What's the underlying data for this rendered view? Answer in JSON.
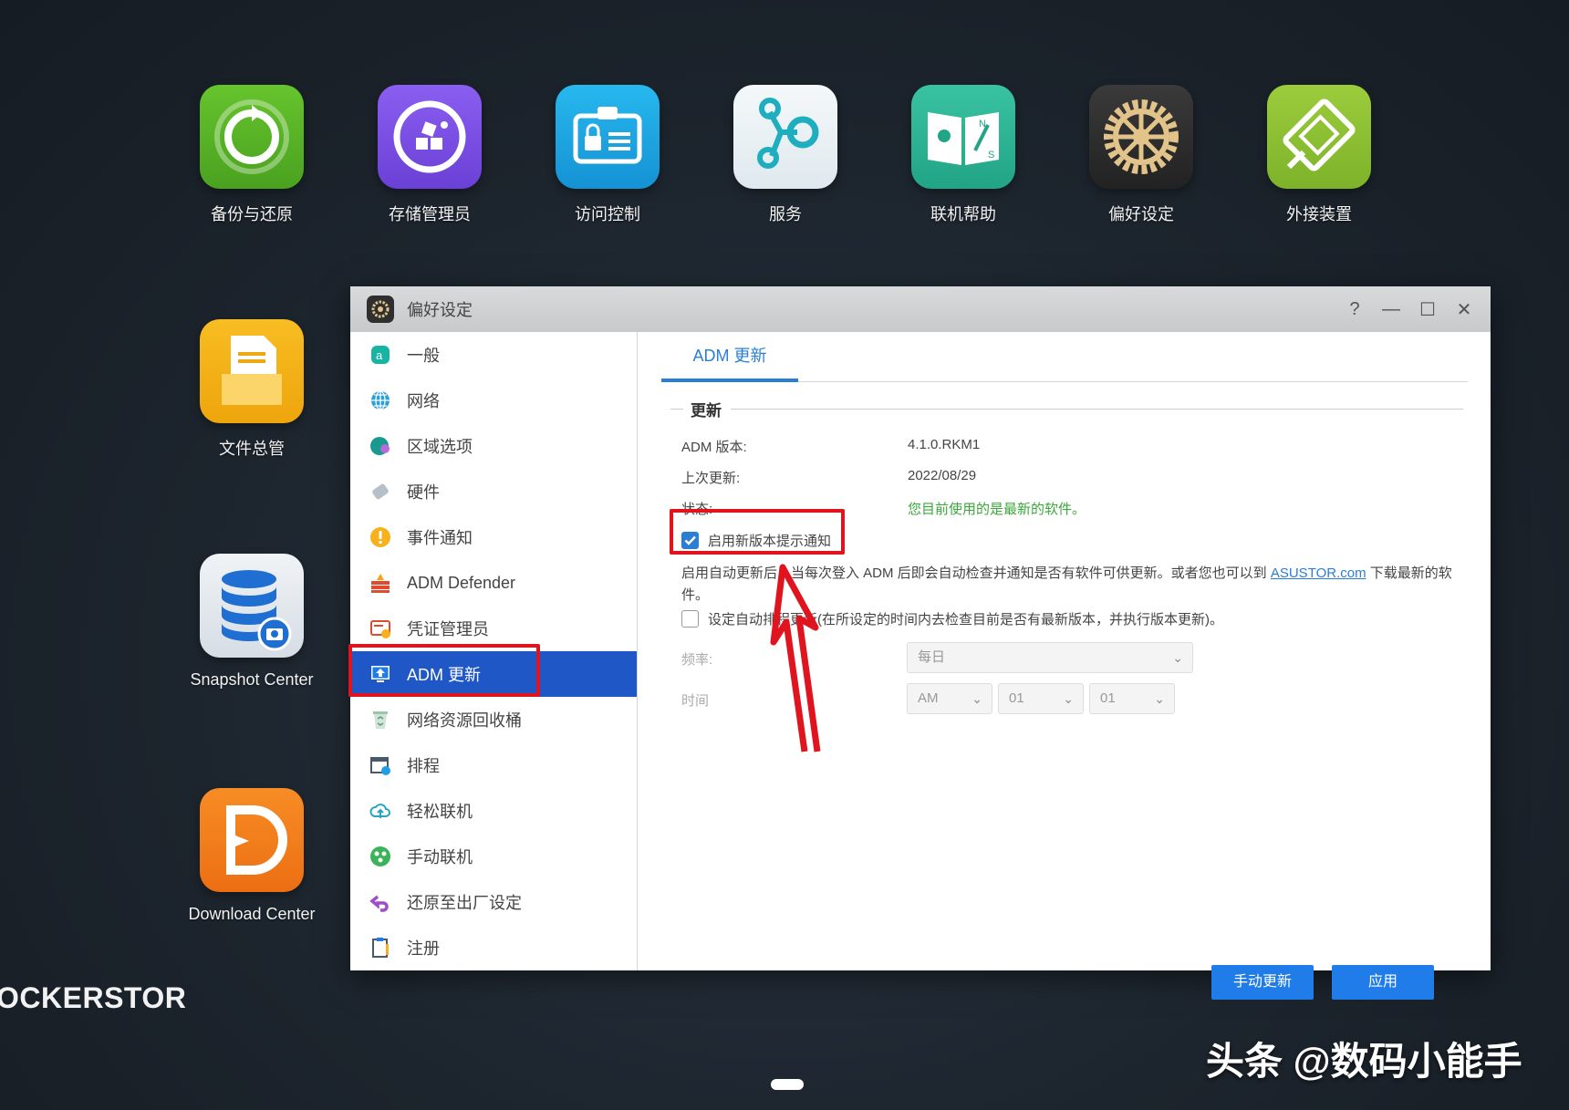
{
  "desktop": {
    "icons": [
      {
        "label": "备份与还原",
        "color": "#5cb82a"
      },
      {
        "label": "存储管理员",
        "color": "#7d52e0"
      },
      {
        "label": "访问控制",
        "color": "#1aa4e0"
      },
      {
        "label": "服务",
        "color": "#e8f2f5"
      },
      {
        "label": "联机帮助",
        "color": "#2eb396"
      },
      {
        "label": "偏好设定",
        "color": "#2c2c2c"
      },
      {
        "label": "外接装置",
        "color": "#8bc43a"
      },
      {
        "label": "文件总管",
        "color": "#f3b017"
      },
      {
        "label": "Snapshot Center",
        "color": "#e6eaee"
      },
      {
        "label": "Download Center",
        "color": "#f07d1c"
      }
    ],
    "brand_text": "OCKERSTOR",
    "watermark": "头条 @数码小能手"
  },
  "window": {
    "title": "偏好设定",
    "controls": {
      "help": "?",
      "minimize": "—",
      "maximize": "☐",
      "close": "✕"
    },
    "sidebar": {
      "items": [
        {
          "label": "一般",
          "icon": "general-icon"
        },
        {
          "label": "网络",
          "icon": "globe-icon"
        },
        {
          "label": "区域选项",
          "icon": "region-icon"
        },
        {
          "label": "硬件",
          "icon": "hardware-icon"
        },
        {
          "label": "事件通知",
          "icon": "alert-icon"
        },
        {
          "label": "ADM Defender",
          "icon": "firewall-icon"
        },
        {
          "label": "凭证管理员",
          "icon": "certificate-icon"
        },
        {
          "label": "ADM 更新",
          "icon": "update-icon"
        },
        {
          "label": "网络资源回收桶",
          "icon": "recycle-bin-icon"
        },
        {
          "label": "排程",
          "icon": "calendar-icon"
        },
        {
          "label": "轻松联机",
          "icon": "cloud-icon"
        },
        {
          "label": "手动联机",
          "icon": "network-icon"
        },
        {
          "label": "还原至出厂设定",
          "icon": "undo-icon"
        },
        {
          "label": "注册",
          "icon": "clipboard-icon"
        }
      ],
      "active_index": 7
    },
    "tab": "ADM 更新",
    "section": "更新",
    "fields": {
      "version_label": "ADM 版本:",
      "version_value": "4.1.0.RKM1",
      "last_update_label": "上次更新:",
      "last_update_value": "2022/08/29",
      "status_label": "状态:",
      "status_value": "您目前使用的是最新的软件。"
    },
    "notify_checkbox": {
      "label": "启用新版本提示通知",
      "checked": true
    },
    "description": {
      "before_link": "启用自动更新后，当每次登入 ADM 后即会自动检查并通知是否有软件可供更新。或者您也可以到 ",
      "link": "ASUSTOR.com",
      "after_link": " 下载最新的软件。"
    },
    "schedule_checkbox": {
      "label": "设定自动排程更新(在所设定的时间内去检查目前是否有最新版本，并执行版本更新)。",
      "checked": false
    },
    "frequency": {
      "label": "频率:",
      "value": "每日"
    },
    "time": {
      "label": "时间",
      "ampm": "AM",
      "hour": "01",
      "minute": "01"
    },
    "buttons": {
      "manual_update": "手动更新",
      "apply": "应用"
    }
  }
}
